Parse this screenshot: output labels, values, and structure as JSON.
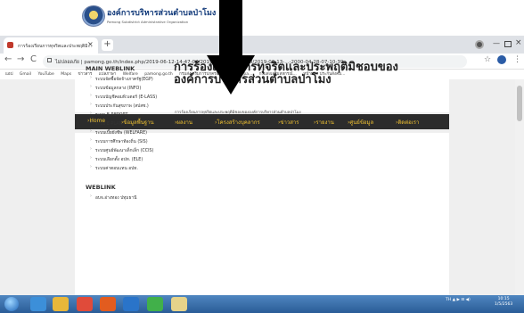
{
  "browser": {
    "tab_title": "การร้องเรียนการทุจริตและประพฤติมิ...",
    "tab_close": "×",
    "new_tab": "+",
    "window_min": "—",
    "window_close": "×",
    "back": "←",
    "forward": "→",
    "reload": "C",
    "url": "ไม่ปลอดภัย | pamong.go.th/index.php/2019-06-12-14-47-04/2019-06-12-14-53-40/2019-06-13-...-2000-04-28-07-10-39",
    "star": "☆",
    "menu": "⋮"
  },
  "bookmarks": [
    "แอป",
    "Gmail",
    "YouTube",
    "Maps",
    "ข่าวสาร",
    "แปลภาษา",
    "Welfare",
    "pamong.go.th",
    "กรมส่งเสริมการปกครองท้องถิ่น (S) - pa...",
    "กรมส่งเสริมสหกรณ์...",
    "หน้าหลัก ประกันสังคม..."
  ],
  "site": {
    "name_th": "องค์การบริหารส่วนตำบลป่าโมง",
    "name_en": "Pamong Subdistrict Administrative Organization"
  },
  "nav": [
    "›Home",
    "›ข้อมูลพื้นฐาน",
    "›ผลงาน",
    "›โครงสร้างบุคลากร",
    "›ข่าวสาร",
    "›รายงาน",
    "›ศูนย์ข้อมูล",
    "›ติดต่อเรา"
  ],
  "sidebar": {
    "title": "MAIN WEBLINK",
    "items": [
      "ระบบจัดซื้อจัดจ้างภาครัฐ(EGP)",
      "ระบบข้อมูลกลาง (INFO)",
      "ระบบบัญชีคอมพิวเตอร์ (E-LASS)",
      "ระบบประกันสุขภาพ (สปสช.)",
      "ระบบ E-REPORT",
      "ระบบ E-PLAN",
      "ระบบเบี้ยยังชีพ (WELFARE)",
      "ระบบการศึกษาท้องถิ่น (SIS)",
      "ระบบศูนย์พัฒนาเด็กเล็ก (CCIS)",
      "ระบบเลือกตั้ง อปท. (ELE)",
      "ระบบค่าตอบแทน อปท."
    ],
    "title2": "WEBLINK",
    "items2": [
      "อบจ.อ่างทอง ปทุมธานี"
    ]
  },
  "article": {
    "title": "การร้องเรียนการทุจริตและประพฤติมิชอบขององค์การบริหารส่วนตำบลป่าโมง",
    "body": "การร้องเรียนการทุจริตและประพฤติมิชอบขององค์การบริหารส่วนตำบลป่าโมง"
  },
  "taskbar": {
    "tray": "TH  ▲  ▶  ⊟  ◀)",
    "time": "10:15",
    "date": "1/5/2563"
  },
  "colors": {
    "nav_bg": "#2c2c2c",
    "nav_text": "#f1c232",
    "taskbar": "#2a5c97",
    "arrow": "#000000"
  }
}
